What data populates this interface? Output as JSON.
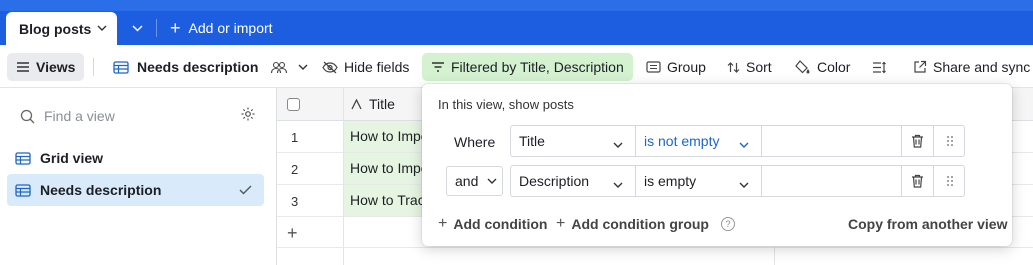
{
  "topbar": {
    "active_tab": "Blog posts",
    "add_import": "Add or import"
  },
  "toolbar": {
    "views": "Views",
    "current_view": "Needs description",
    "hide_fields": "Hide fields",
    "filter": "Filtered by Title, Description",
    "group": "Group",
    "sort": "Sort",
    "color": "Color",
    "share": "Share and sync"
  },
  "sidebar": {
    "find_placeholder": "Find a view",
    "items": [
      {
        "label": "Grid view",
        "selected": false
      },
      {
        "label": "Needs description",
        "selected": true
      }
    ]
  },
  "grid": {
    "title_header": "Title",
    "rows": [
      {
        "num": "1",
        "title": "How to Impo"
      },
      {
        "num": "2",
        "title": "How to Impo"
      },
      {
        "num": "3",
        "title": "How to Trac"
      }
    ]
  },
  "filter_popover": {
    "heading": "In this view, show posts",
    "conditions": [
      {
        "conjunction": "Where",
        "field": "Title",
        "operator": "is not empty",
        "value": ""
      },
      {
        "conjunction": "and",
        "field": "Description",
        "operator": "is empty",
        "value": ""
      }
    ],
    "add_condition": "Add condition",
    "add_condition_group": "Add condition group",
    "copy_from": "Copy from another view"
  },
  "colors": {
    "topbar_blue": "#1d5ee0",
    "filter_green": "#d4f1d0",
    "selected_view": "#d9ebfb",
    "operator_blue": "#1a66d0"
  }
}
